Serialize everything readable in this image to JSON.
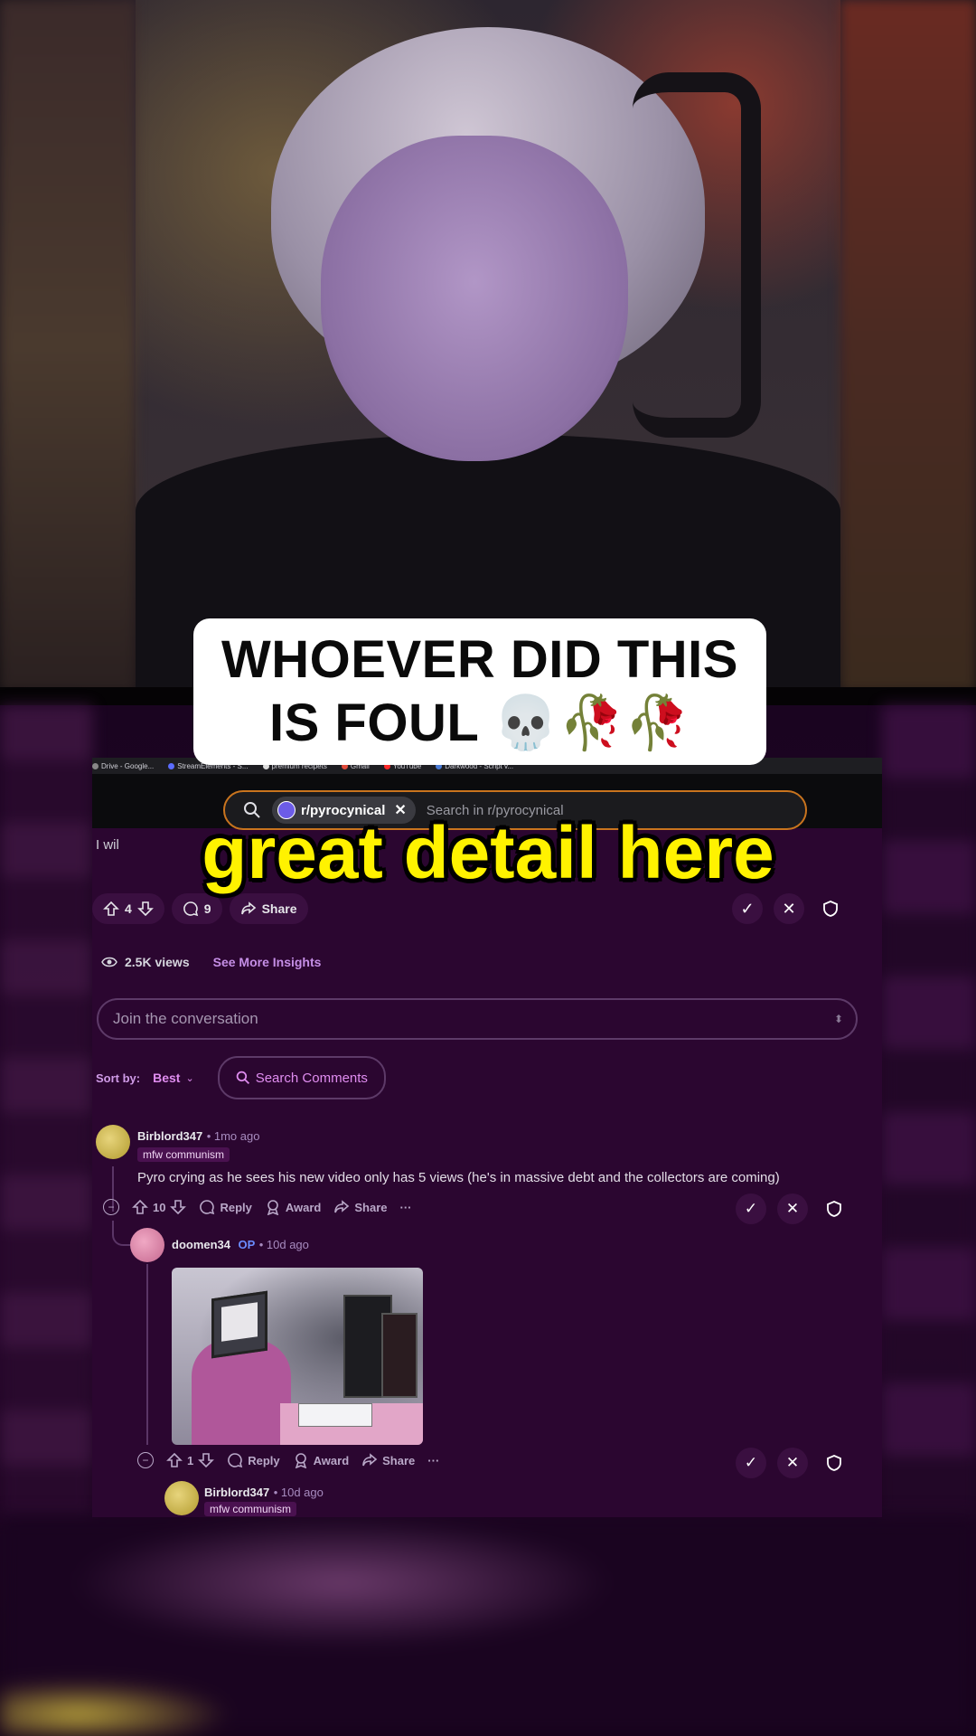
{
  "caption": {
    "line1": "WHOEVER DID THIS",
    "line2": "IS FOUL 💀🥀🥀"
  },
  "hook_text": "great detail here",
  "browser": {
    "bookmarks": [
      "Drive - Google...",
      "StreamElements - S...",
      "premium recipets",
      "Gmail",
      "YouTube",
      "Darkwood - Script v..."
    ],
    "search_chip": "r/pyrocynical",
    "search_placeholder": "Search in r/pyrocynical"
  },
  "post": {
    "body_snippet": "I wil",
    "votes": "4",
    "comments": "9",
    "share_label": "Share",
    "views": "2.5K views",
    "insights_label": "See More Insights",
    "join_placeholder": "Join the conversation",
    "sort_label": "Sort by:",
    "sort_value": "Best",
    "search_comments_label": "Search Comments"
  },
  "comments": [
    {
      "user": "Birblord347",
      "time": "1mo ago",
      "flair": "mfw communism",
      "text": "Pyro crying as he sees his new video only has 5 views (he's in massive debt and the collectors are coming)",
      "votes": "10",
      "reply_label": "Reply",
      "award_label": "Award",
      "share_label": "Share"
    },
    {
      "user": "doomen34",
      "op_label": "OP",
      "time": "10d ago",
      "votes": "1",
      "reply_label": "Reply",
      "award_label": "Award",
      "share_label": "Share"
    },
    {
      "user": "Birblord347",
      "time": "10d ago",
      "flair": "mfw communism"
    }
  ],
  "colors": {
    "accent": "#c9741e",
    "background": "#2b0630",
    "hook": "#fff200"
  }
}
